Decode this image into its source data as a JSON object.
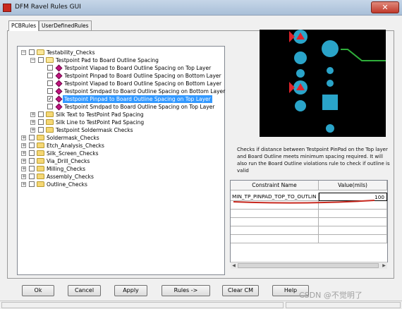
{
  "window": {
    "title": "DFM Ravel Rules GUI",
    "close_glyph": "✕"
  },
  "tabs": [
    {
      "label": "PCBRules",
      "active": true
    },
    {
      "label": "UserDefinedRules",
      "active": false
    }
  ],
  "tree": {
    "expand_glyph": "+",
    "collapse_glyph": "−",
    "check_glyph": "✓",
    "nodes": [
      {
        "label": "Testability_Checks",
        "expanded": true,
        "kind": "folder"
      },
      {
        "label": "Testpoint Pad to Board Outline Spacing",
        "expanded": true,
        "kind": "folder"
      },
      {
        "label": "Testpoint Viapad to Board Outline Spacing on Top Layer",
        "checked": false,
        "kind": "rule"
      },
      {
        "label": "Testpoint Pinpad to Board Outline Spacing on Bottom Layer",
        "checked": false,
        "kind": "rule"
      },
      {
        "label": "Testpoint Viapad to Board Outline Spacing on Bottom Layer",
        "checked": false,
        "kind": "rule"
      },
      {
        "label": "Testpoint Smdpad to Board Outline Spacing on Bottom Layer",
        "checked": false,
        "kind": "rule"
      },
      {
        "label": "Testpoint Pinpad to Board Outline Spacing on Top Layer",
        "checked": true,
        "selected": true,
        "kind": "rule"
      },
      {
        "label": "Testpoint Smdpad to Board Outline Spacing on Top Layer",
        "checked": false,
        "kind": "rule"
      },
      {
        "label": "Silk Text to TestPoint Pad Spacing",
        "expanded": false,
        "kind": "folder"
      },
      {
        "label": "Silk Line to TestPoint Pad Spacing",
        "expanded": false,
        "kind": "folder"
      },
      {
        "label": "Testpoint Soldermask Checks",
        "expanded": false,
        "kind": "folder"
      },
      {
        "label": "Soldermask_Checks",
        "expanded": false,
        "kind": "folder"
      },
      {
        "label": "Etch_Analysis_Checks",
        "expanded": false,
        "kind": "folder"
      },
      {
        "label": "Silk_Screen_Checks",
        "expanded": false,
        "kind": "folder"
      },
      {
        "label": "Via_Drill_Checks",
        "expanded": false,
        "kind": "folder"
      },
      {
        "label": "Milling_Checks",
        "expanded": false,
        "kind": "folder"
      },
      {
        "label": "Assembly_Checks",
        "expanded": false,
        "kind": "folder"
      },
      {
        "label": "Outline_Checks",
        "expanded": false,
        "kind": "folder"
      }
    ]
  },
  "description": "Checks if distance between Testpoint PinPad on the Top layer and Board Outline meets minimum spacing required. It will also run the Board Outline violations rule to check if outline is valid",
  "constraint_table": {
    "headers": [
      "Constraint Name",
      "Value(mils)"
    ],
    "rows": [
      {
        "name": "MIN_TP_PINPAD_TOP_TO_OUTLIN",
        "value": "100"
      }
    ]
  },
  "buttons": [
    "Ok",
    "Cancel",
    "Apply",
    "Rules ->",
    "Clear CM",
    "Help"
  ],
  "scroll_glyphs": {
    "left": "◀",
    "right": "▶"
  },
  "watermark": "CSDN @不觉明了",
  "colors": {
    "selection": "#3399ff",
    "preview_bg": "#000000",
    "pad": "#2aa4c9",
    "marker": "#e1232b",
    "trace": "#2fae3a",
    "annotation": "#c8281e"
  }
}
